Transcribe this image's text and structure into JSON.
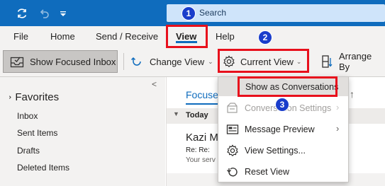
{
  "title_bar": {
    "search_placeholder": "Search",
    "icons": [
      "sync-icon",
      "undo-icon",
      "customize-quick-access-icon",
      "search-icon"
    ]
  },
  "menu": {
    "tabs": [
      "File",
      "Home",
      "Send / Receive",
      "View",
      "Help"
    ],
    "active_tab": "View"
  },
  "ribbon": {
    "show_focused_inbox": "Show Focused Inbox",
    "change_view": "Change View",
    "current_view": "Current View",
    "arrange_by": "Arrange By"
  },
  "nav": {
    "favorites_label": "Favorites",
    "items": [
      "Inbox",
      "Sent Items",
      "Drafts",
      "Deleted Items"
    ]
  },
  "message_list": {
    "focused_tab": "Focused",
    "group_label": "Today",
    "sender": "Kazi M",
    "subject": "Re: Re:",
    "preview": "Your serv"
  },
  "dropdown": {
    "items": [
      {
        "label": "Show as Conversations",
        "icon": "",
        "disabled": false,
        "submenu": false
      },
      {
        "label": "Conversation Settings",
        "icon": "conversation-settings-icon",
        "disabled": true,
        "submenu": true
      },
      {
        "label": "Message Preview",
        "icon": "message-preview-icon",
        "disabled": false,
        "submenu": true
      },
      {
        "label": "View Settings...",
        "icon": "gear-icon",
        "disabled": false,
        "submenu": false
      },
      {
        "label": "Reset View",
        "icon": "reset-icon",
        "disabled": false,
        "submenu": false
      }
    ]
  },
  "annotations": {
    "markers": [
      "1",
      "2",
      "3"
    ],
    "highlight_color": "#e8101c",
    "marker_color": "#1a3dcb"
  },
  "colors": {
    "accent": "#0f6cbd",
    "ribbon_bg": "#f3f2f1"
  }
}
